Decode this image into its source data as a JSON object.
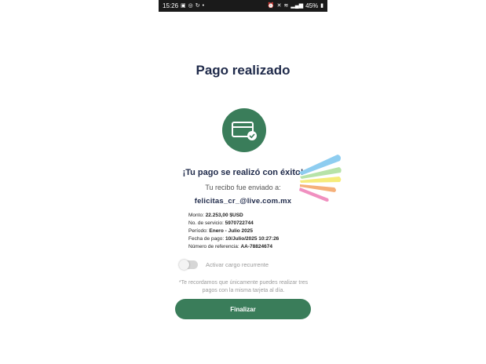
{
  "status_bar": {
    "time": "15:26",
    "battery": "45%",
    "left_icons": [
      "image-icon",
      "whatsapp-icon",
      "sync-icon",
      "dot-icon"
    ],
    "right_icons": [
      "alarm-icon",
      "mute-icon",
      "vibrate-icon",
      "signal-icon",
      "battery-icon"
    ]
  },
  "page": {
    "title": "Pago realizado",
    "success_title": "¡Tu pago se realizó con éxito!",
    "receipt_text": "Tu recibo fue enviado a:",
    "email": "felicitas_cr_@live.com.mx"
  },
  "details": [
    {
      "label": "Monto:",
      "value": "22.253,00 $USD"
    },
    {
      "label": "No. de servicio:",
      "value": "5970722744"
    },
    {
      "label": "Período:",
      "value": "Enero - Julio 2025"
    },
    {
      "label": "Fecha de pago:",
      "value": "10/Julio/2025 10:27:26"
    },
    {
      "label": "Número de referencia:",
      "value": "AA-78824674"
    }
  ],
  "recurring": {
    "label": "Activar cargo recurrente",
    "enabled": false
  },
  "note": "*Te recordamos que únicamente puedes realizar tres pagos con la misma tarjeta al día.",
  "finish_label": "Finalizar",
  "colors": {
    "primary_green": "#3a7d5a",
    "title_navy": "#1f2a4a",
    "status_bar_bg": "#1a1a1a"
  },
  "icons": {
    "main": "card-check-icon",
    "decoration": "confetti-icon"
  }
}
